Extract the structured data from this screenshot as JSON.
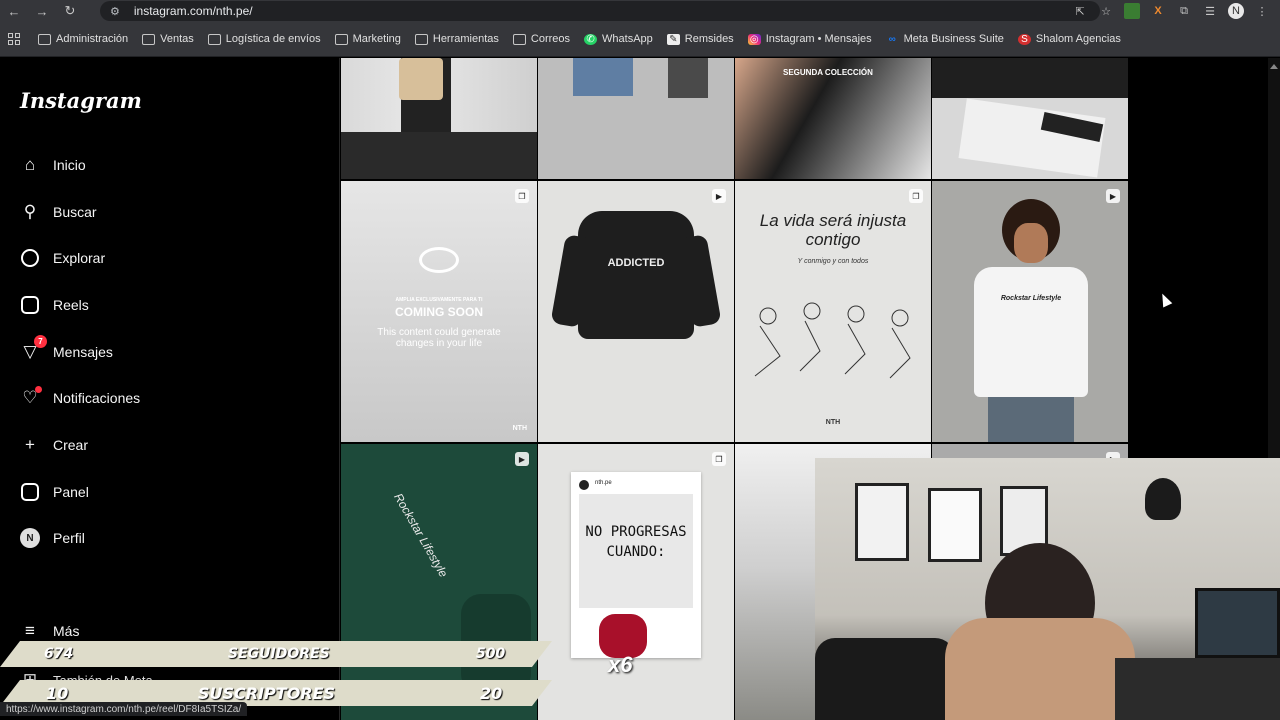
{
  "browser": {
    "url": "instagram.com/nth.pe/",
    "status_url": "https://www.instagram.com/nth.pe/reel/DF8Ia5TSIZa/"
  },
  "bookmarks": [
    {
      "label": "Administración",
      "icon": "folder-icon"
    },
    {
      "label": "Ventas",
      "icon": "folder-icon"
    },
    {
      "label": "Logística de envíos",
      "icon": "folder-icon"
    },
    {
      "label": "Marketing",
      "icon": "folder-icon"
    },
    {
      "label": "Herramientas",
      "icon": "folder-icon"
    },
    {
      "label": "Correos",
      "icon": "folder-icon"
    },
    {
      "label": "WhatsApp",
      "icon": "whatsapp-icon"
    },
    {
      "label": "Remsides",
      "icon": "remsides-icon"
    },
    {
      "label": "Instagram • Mensajes",
      "icon": "instagram-icon"
    },
    {
      "label": "Meta Business Suite",
      "icon": "meta-icon"
    },
    {
      "label": "Shalom Agencias",
      "icon": "shalom-icon"
    }
  ],
  "sidebar": {
    "logo": "Instagram",
    "items": [
      {
        "label": "Inicio"
      },
      {
        "label": "Buscar"
      },
      {
        "label": "Explorar"
      },
      {
        "label": "Reels"
      },
      {
        "label": "Mensajes",
        "badge": "7"
      },
      {
        "label": "Notificaciones"
      },
      {
        "label": "Crear"
      },
      {
        "label": "Panel"
      },
      {
        "label": "Perfil"
      },
      {
        "label": "Más"
      },
      {
        "label": "También de Meta"
      }
    ]
  },
  "posts": {
    "coming_soon_small": "AMPLIA EXCLUSIVAMENTE PARA TI",
    "coming_soon_title": "COMING SOON",
    "coming_soon_sub": "This content could generate changes in your life",
    "nth": "NTH",
    "hoodie_text": "ADDICTED",
    "vida_title": "La vida será injusta contigo",
    "vida_sub": "Y conmigo y con todos",
    "coleccion": "SEGUNDA COLECCIÓN",
    "card_user": "nth.pe",
    "card_text": "NO PROGRESAS CUANDO:",
    "x6": "x6",
    "shirt_text": "Rockstar Lifestyle"
  },
  "overlay": {
    "followers_count": "674",
    "followers_label": "SEGUIDORES",
    "followers_goal": "500",
    "subscribers_count": "10",
    "subscribers_label": "SUSCRIPTORES",
    "subscribers_goal": "20"
  },
  "colors": {
    "badge_red": "#ff3040",
    "overlay_bar": "#dedcca"
  }
}
